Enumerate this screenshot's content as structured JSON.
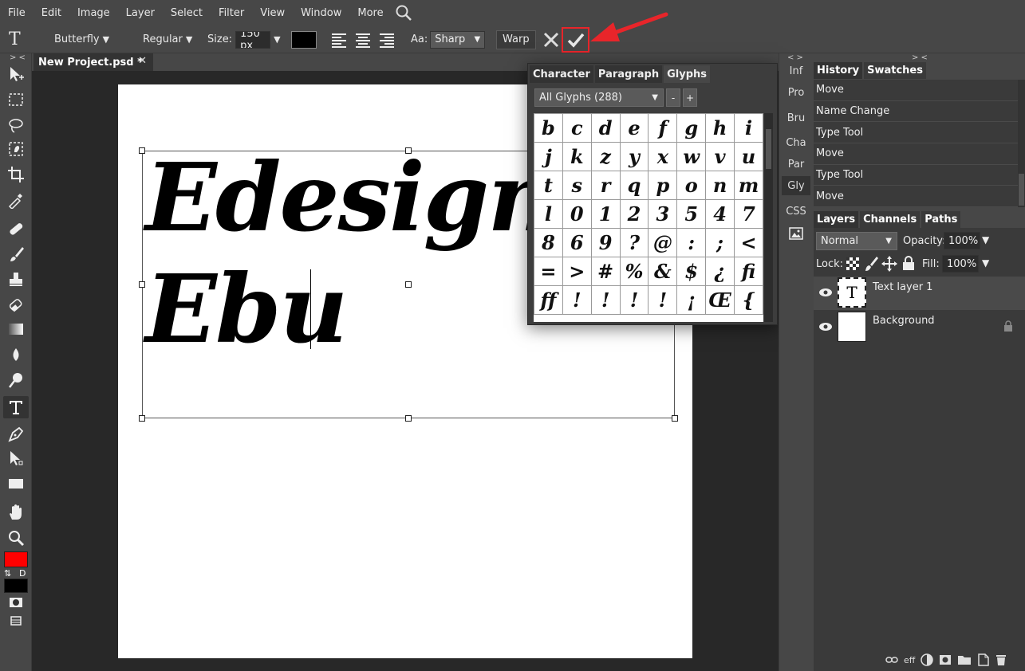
{
  "menu": [
    "File",
    "Edit",
    "Image",
    "Layer",
    "Select",
    "Filter",
    "View",
    "Window",
    "More"
  ],
  "options": {
    "tool_glyph": "T",
    "font_family": "Butterfly",
    "font_style": "Regular",
    "size_label": "Size:",
    "size_value": "150 px",
    "aa_label": "Aa:",
    "aa_value": "Sharp",
    "warp_label": "Warp",
    "text_color": "#000000"
  },
  "document": {
    "tab_title": "New Project.psd *",
    "tab_close": "✕",
    "collapse_marker": "> <",
    "canvas_text_line1": "Edesign3",
    "canvas_text_line2": "Ebu"
  },
  "glyphs_panel": {
    "tabs": [
      "Character",
      "Paragraph",
      "Glyphs"
    ],
    "active_tab": "Glyphs",
    "filter": "All Glyphs (288)",
    "minus": "-",
    "plus": "+",
    "rows": [
      [
        "b",
        "c",
        "d",
        "e",
        "f",
        "g",
        "h",
        "i"
      ],
      [
        "j",
        "k",
        "z",
        "y",
        "x",
        "w",
        "v",
        "u"
      ],
      [
        "t",
        "s",
        "r",
        "q",
        "p",
        "o",
        "n",
        "m"
      ],
      [
        "l",
        "0",
        "1",
        "2",
        "3",
        "5",
        "4",
        "7"
      ],
      [
        "8",
        "6",
        "9",
        "?",
        "@",
        ":",
        ";",
        "<"
      ],
      [
        "=",
        ">",
        "#",
        "%",
        "&",
        "$",
        "¿",
        "fi"
      ],
      [
        "ff",
        "!",
        "!",
        "!",
        "!",
        "¡",
        "Œ",
        "{"
      ]
    ]
  },
  "mini_panels": {
    "collapse_marker": "< >",
    "items": [
      "Inf",
      "Pro",
      "Bru",
      "Cha",
      "Par",
      "Gly",
      "CSS"
    ],
    "active": "Gly"
  },
  "history_panel": {
    "collapse_marker": "> <",
    "tabs": [
      "History",
      "Swatches"
    ],
    "items": [
      "Move",
      "Name Change",
      "Type Tool",
      "Move",
      "Type Tool",
      "Move"
    ]
  },
  "layers_panel": {
    "tabs": [
      "Layers",
      "Channels",
      "Paths"
    ],
    "blend_mode": "Normal",
    "opacity_label": "Opacity:",
    "opacity_value": "100%",
    "lock_label": "Lock:",
    "fill_label": "Fill:",
    "fill_value": "100%",
    "layers": [
      {
        "name": "Text layer 1",
        "thumb": "T",
        "selected": true
      },
      {
        "name": "Background",
        "thumb": "",
        "selected": false
      }
    ],
    "footer_eff": "eff"
  },
  "colors": {
    "foreground": "#ff0000",
    "background": "#000000",
    "accent_arrow": "#e8252a"
  },
  "toolbar_labels": {
    "swap": "⇅",
    "default": "D"
  }
}
